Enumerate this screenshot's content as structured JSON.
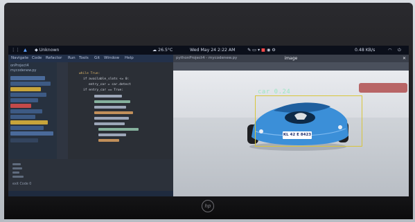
{
  "topbar": {
    "app_label": "Unknown",
    "weather": "26.5°C",
    "clock": "Wed May 24  2:22 AM",
    "net_speed": "0.48 KB/s"
  },
  "ide": {
    "menu": [
      "Navigate",
      "Code",
      "Refactor",
      "Run",
      "Tools",
      "Git",
      "Window",
      "Help"
    ],
    "file_tab": "mycodenew.py",
    "project_title": "onProject4",
    "console_text": "exit Code 0",
    "code_snippet": [
      "while True:",
      "if available_slots <= 0:",
      "entry_car = car.detect",
      "if entry_car == True:"
    ]
  },
  "image_window": {
    "window_title": "pythonProject4 - mycodenew.py",
    "title": "image",
    "detection_label": "car  0.24",
    "plate_text": "KL 42 E 8423"
  },
  "laptop": {
    "brand_mark": "hp"
  },
  "colors": {
    "car_body": "#3b8fd8",
    "box": "#d8c53a",
    "label": "#9be6c4"
  }
}
